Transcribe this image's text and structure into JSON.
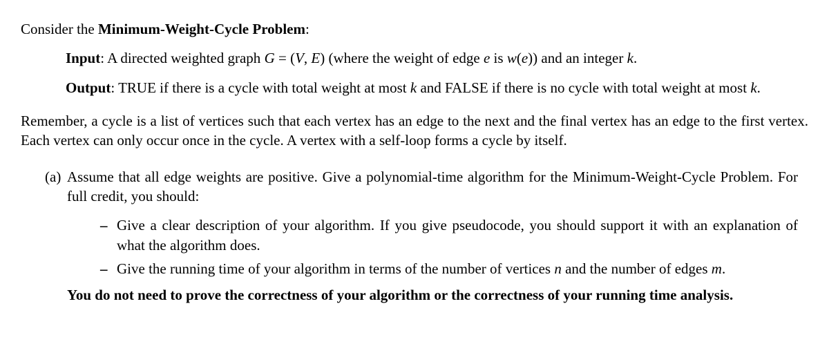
{
  "intro_prefix": "Consider the ",
  "intro_bold": "Minimum-Weight-Cycle Problem",
  "intro_suffix": ":",
  "input_label": "Input",
  "input_t1": ": A directed weighted graph ",
  "input_G": "G",
  "input_eq": " = (",
  "input_V": "V",
  "input_comma": ", ",
  "input_E": "E",
  "input_t2": ") (where the weight of edge ",
  "input_e": "e",
  "input_t3": " is ",
  "input_w": "w",
  "input_paren_open": "(",
  "input_e2": "e",
  "input_paren_close": ")",
  "input_t4": ") and an integer ",
  "input_k": "k",
  "input_period": ".",
  "output_label": "Output",
  "output_t1": ": TRUE if there is a cycle with total weight at most ",
  "output_k1": "k",
  "output_t2": " and FALSE if there is no cycle with total weight at most ",
  "output_k2": "k",
  "output_period": ".",
  "remember": "Remember, a cycle is a list of vertices such that each vertex has an edge to the next and the final vertex has an edge to the first vertex. Each vertex can only occur once in the cycle. A vertex with a self-loop forms a cycle by itself.",
  "part_label": "(a)",
  "part_text": "Assume that all edge weights are positive. Give a polynomial-time algorithm for the Minimum-Weight-Cycle Problem. For full credit, you should:",
  "bullet_mark": "–",
  "bullet1": "Give a clear description of your algorithm. If you give pseudocode, you should support it with an explanation of what the algorithm does.",
  "bullet2_t1": "Give the running time of your algorithm in terms of the number of vertices ",
  "bullet2_n": "n",
  "bullet2_t2": " and the number of edges ",
  "bullet2_m": "m",
  "bullet2_period": ".",
  "closing": "You do not need to prove the correctness of your algorithm or the correctness of your running time analysis."
}
